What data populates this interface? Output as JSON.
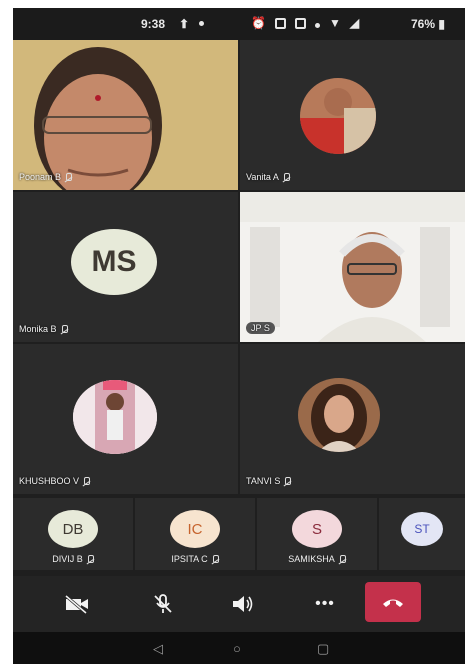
{
  "status_bar": {
    "time": "9:38",
    "battery": "76%"
  },
  "participants": [
    {
      "name": "Poonam B"
    },
    {
      "name": "Vanita A"
    },
    {
      "name": "Monika B",
      "initials": "MS"
    },
    {
      "name": "",
      "badge": "JP S"
    },
    {
      "name": "KHUSHBOO V"
    },
    {
      "name": "TANVI S"
    }
  ],
  "mini_participants": [
    {
      "initials": "DB",
      "name": "DIVIJ B"
    },
    {
      "initials": "IC",
      "name": "IPSITA C"
    },
    {
      "initials": "S",
      "name": "SAMIKSHA"
    },
    {
      "initials": "ST",
      "name": ""
    }
  ],
  "controls": {
    "camera": "video-off-icon",
    "mic": "mic-off-icon",
    "speaker": "speaker-icon",
    "more": "•••",
    "end": "end-call-icon",
    "end_color": "#c4314b"
  },
  "navigation": {
    "back": "◁",
    "home": "○",
    "recents": "▢"
  }
}
